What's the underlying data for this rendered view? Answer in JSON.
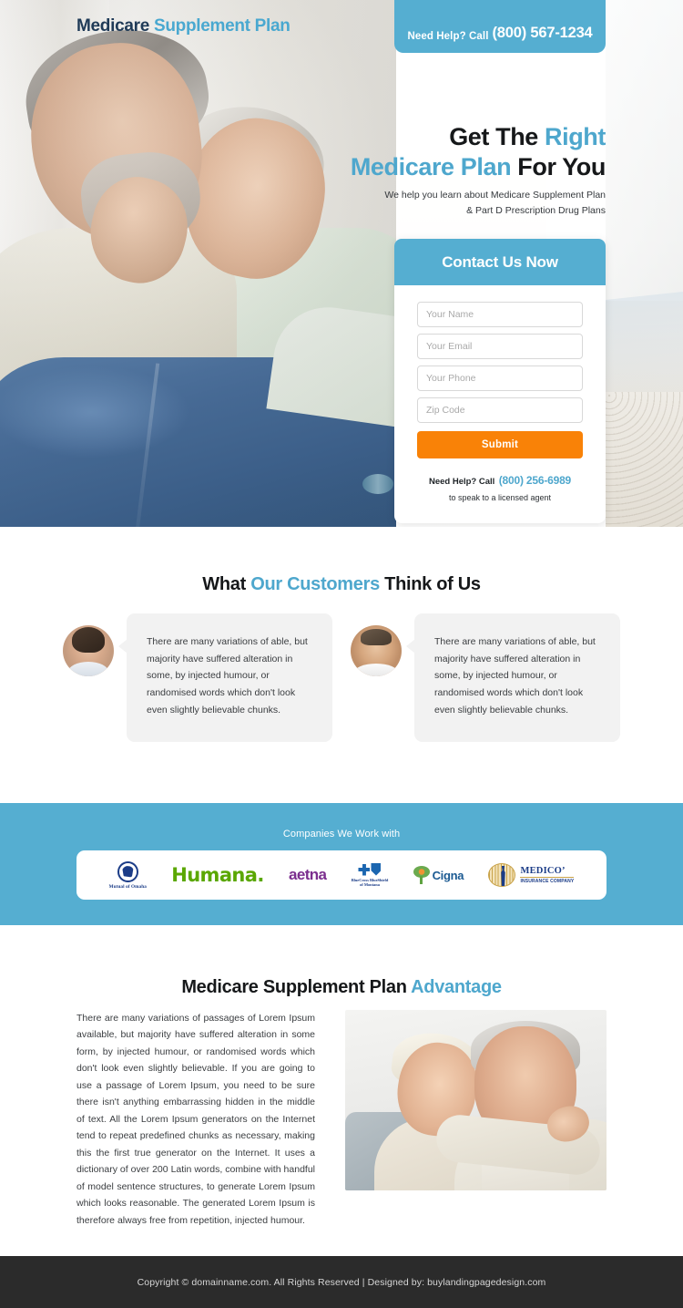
{
  "brand": {
    "part1": "Medicare",
    "part2": "Supplement Plan"
  },
  "header": {
    "help_label": "Need Help? Call",
    "help_phone": "(800) 567-1234"
  },
  "hero": {
    "headline_line1_dark": "Get The ",
    "headline_line1_blue": "Right",
    "headline_line2_blue": "Medicare Plan ",
    "headline_line2_dark": "For You",
    "subtext_line1": "We help you learn about Medicare Supplement Plan",
    "subtext_line2": "& Part D Prescription Drug Plans"
  },
  "form": {
    "title": "Contact Us Now",
    "fields": [
      {
        "name": "name",
        "placeholder": "Your Name",
        "value": ""
      },
      {
        "name": "email",
        "placeholder": "Your Email",
        "value": ""
      },
      {
        "name": "phone",
        "placeholder": "Your Phone",
        "value": ""
      },
      {
        "name": "zip",
        "placeholder": "Zip Code",
        "value": ""
      }
    ],
    "submit_label": "Submit",
    "footer_label": "Need Help? Call",
    "footer_phone": "(800) 256-6989",
    "footer_note": "to speak to a licensed agent"
  },
  "testimonials": {
    "title_part1": "What ",
    "title_blue": "Our Customers",
    "title_part2": " Think of Us",
    "items": [
      {
        "avatar": "avatar-male-young",
        "quote": "There are many variations of able, but majority have suffered alteration in some, by injected humour, or randomised words which don't look even slightly believable chunks."
      },
      {
        "avatar": "avatar-male-bald",
        "quote": "There are many variations of able, but majority have suffered alteration in some, by injected humour, or randomised words which don't look even slightly believable chunks."
      }
    ]
  },
  "partners": {
    "title": "Companies We Work with",
    "logos": [
      {
        "id": "mutual-of-omaha",
        "name": "Mutual of Omaha"
      },
      {
        "id": "humana",
        "name": "Humana."
      },
      {
        "id": "aetna",
        "name": "aetna"
      },
      {
        "id": "blue-cross-blue-shield",
        "name": "BlueCross BlueShield",
        "sub": "of Montana"
      },
      {
        "id": "cigna",
        "name": "Cigna"
      },
      {
        "id": "medico",
        "name": "MEDICO’",
        "sub": "INSURANCE COMPANY"
      }
    ]
  },
  "advantage": {
    "title_dark": "Medicare Supplement Plan ",
    "title_blue": "Advantage",
    "body": "There are many variations of passages of Lorem Ipsum available, but majority have suffered alteration in some form, by injected humour, or randomised words which don't look even slightly believable. If you are going to use a passage of Lorem Ipsum, you need to be sure there isn't anything embarrassing hidden in the middle of text. All the Lorem Ipsum generators on the Internet tend to repeat predefined chunks as necessary, making this the first true generator on the Internet. It uses a dictionary of over 200 Latin words, combine with handful of model sentence structures, to generate Lorem Ipsum which looks reasonable. The generated Lorem Ipsum is therefore always free from repetition, injected humour.",
    "photo": "senior-couple-embracing"
  },
  "footer": {
    "text": "Copyright © domainname.com. All Rights Reserved  |  Designed by: buylandingpagedesign.com"
  },
  "colors": {
    "brand_blue": "#4ea7cd",
    "band_blue": "#55aed1",
    "submit_orange": "#f98207",
    "dark_text": "#16181a",
    "footer_bg": "#2b2b2b"
  }
}
